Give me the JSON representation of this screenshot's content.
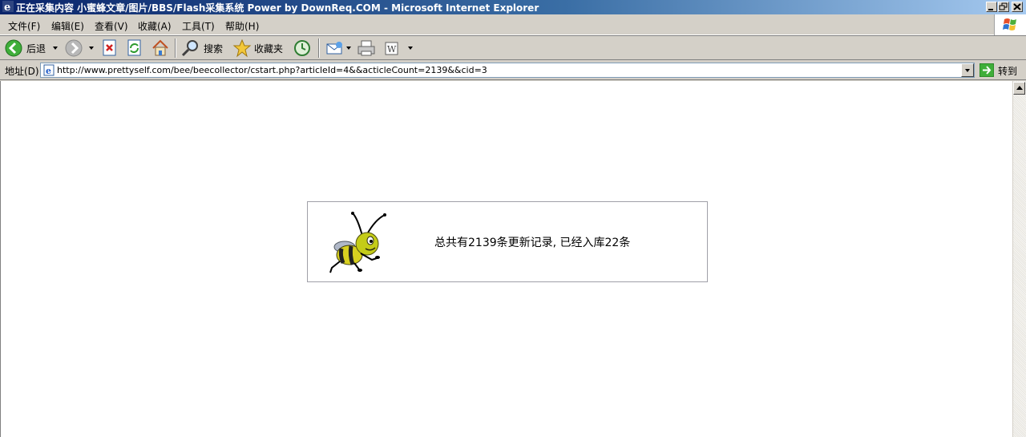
{
  "window": {
    "title": "正在采集内容 小蜜蜂文章/图片/BBS/Flash采集系统 Power by DownReq.COM - Microsoft Internet Explorer",
    "controls": [
      "minimize",
      "restore",
      "close"
    ]
  },
  "menubar": {
    "items": [
      "文件(F)",
      "编辑(E)",
      "查看(V)",
      "收藏(A)",
      "工具(T)",
      "帮助(H)"
    ]
  },
  "toolbar": {
    "back_label": "后退",
    "search_label": "搜索",
    "favorites_label": "收藏夹"
  },
  "addressbar": {
    "label": "地址(D)",
    "url": "http://www.prettyself.com/bee/beecollector/cstart.php?articleId=4&&acticleCount=2139&&cid=3",
    "go_label": "转到"
  },
  "content": {
    "message": "总共有2139条更新记录, 已经入库22条"
  },
  "colors": {
    "titlebar_start": "#0a246a",
    "titlebar_end": "#a6caf0",
    "chrome": "#d4d0c8"
  }
}
